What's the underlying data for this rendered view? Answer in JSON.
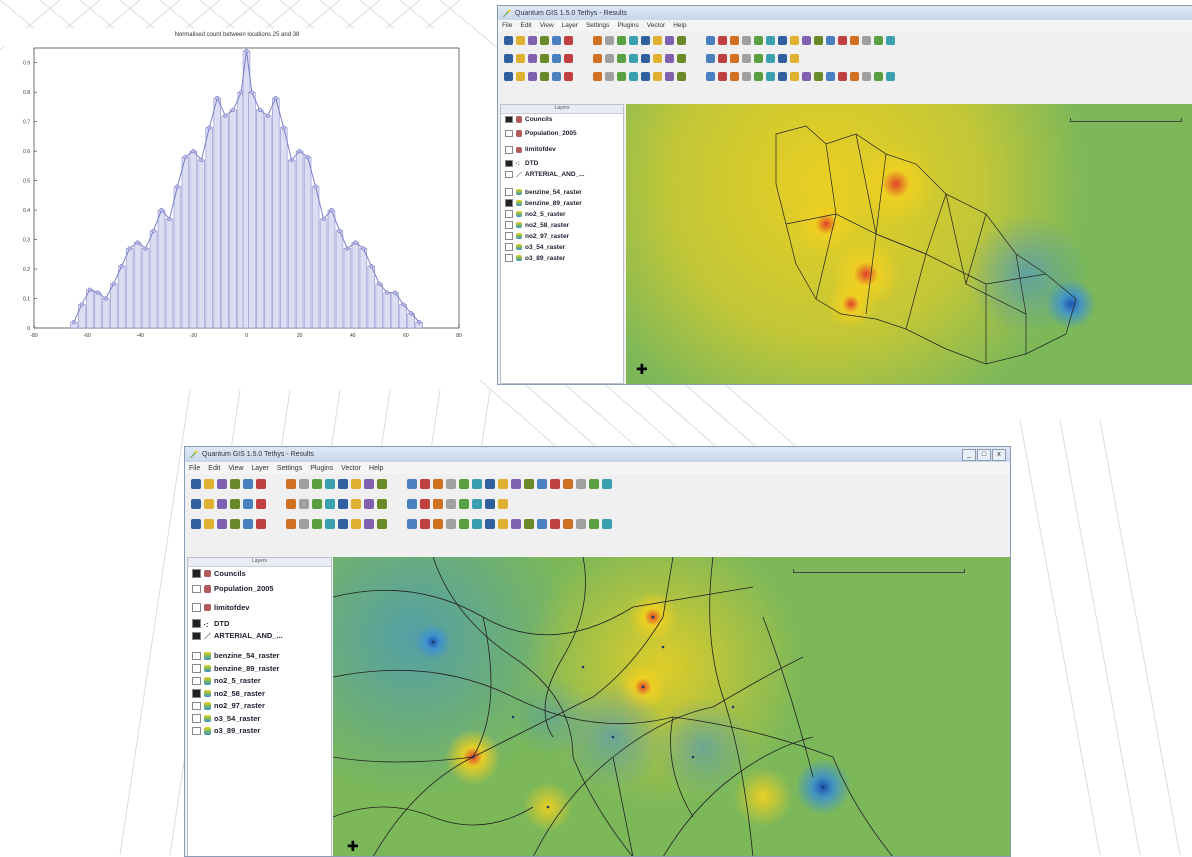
{
  "chart_data": {
    "type": "bar",
    "title": "Normalised count between locations 25 and 38",
    "xticks": [
      "-80",
      "-60",
      "-40",
      "-20",
      "0",
      "20",
      "40",
      "60",
      "80"
    ],
    "yticks": [
      "0",
      "0.1",
      "0.2",
      "0.3",
      "0.4",
      "0.5",
      "0.6",
      "0.7",
      "0.8",
      "0.9"
    ],
    "xlim": [
      -80,
      80
    ],
    "ylim": [
      0,
      0.95
    ],
    "x": [
      -65,
      -62,
      -59,
      -56,
      -53,
      -50,
      -47,
      -44,
      -41,
      -38,
      -35,
      -32,
      -29,
      -26,
      -23,
      -20,
      -17,
      -14,
      -11,
      -8,
      -5,
      -2,
      0,
      2,
      5,
      8,
      11,
      14,
      17,
      20,
      23,
      26,
      29,
      32,
      35,
      38,
      41,
      44,
      47,
      50,
      53,
      56,
      59,
      62,
      65
    ],
    "values": [
      0.02,
      0.08,
      0.13,
      0.12,
      0.1,
      0.15,
      0.21,
      0.27,
      0.29,
      0.27,
      0.33,
      0.4,
      0.37,
      0.48,
      0.58,
      0.6,
      0.57,
      0.68,
      0.78,
      0.72,
      0.74,
      0.8,
      0.94,
      0.8,
      0.74,
      0.72,
      0.78,
      0.68,
      0.57,
      0.6,
      0.58,
      0.48,
      0.37,
      0.4,
      0.33,
      0.27,
      0.29,
      0.27,
      0.21,
      0.15,
      0.12,
      0.12,
      0.08,
      0.05,
      0.02
    ],
    "color": "#7b7fc8"
  },
  "window_top": {
    "title": "Quantum GIS 1.5.0 Tethys - Results",
    "menu": [
      "File",
      "Edit",
      "View",
      "Layer",
      "Settings",
      "Plugins",
      "Vector",
      "Help"
    ],
    "layers_panel_title": "Layers",
    "layers": [
      {
        "name": "Councils",
        "checked": true,
        "symbol": "#b05a5a"
      },
      {
        "name": "Population_2005",
        "checked": false,
        "symbol": "#b05a5a"
      },
      {
        "name": "limitofdev",
        "checked": false,
        "symbol": "#b05a5a"
      },
      {
        "name": "DTD",
        "checked": true,
        "symbol": "point-layer-icon"
      },
      {
        "name": "ARTERIAL_AND_...",
        "checked": false,
        "symbol": "line-layer-icon"
      },
      {
        "name": "benzine_54_raster",
        "checked": false,
        "symbol": "raster"
      },
      {
        "name": "benzine_89_raster",
        "checked": true,
        "symbol": "raster"
      },
      {
        "name": "no2_5_raster",
        "checked": false,
        "symbol": "raster"
      },
      {
        "name": "no2_58_raster",
        "checked": false,
        "symbol": "raster"
      },
      {
        "name": "no2_97_raster",
        "checked": false,
        "symbol": "raster"
      },
      {
        "name": "o3_54_raster",
        "checked": false,
        "symbol": "raster"
      },
      {
        "name": "o3_89_raster",
        "checked": false,
        "symbol": "raster"
      }
    ]
  },
  "window_bottom": {
    "title": "Quantum GIS 1.5.0 Tethys - Results",
    "window_buttons": [
      "_",
      "□",
      "x"
    ],
    "menu": [
      "File",
      "Edit",
      "View",
      "Layer",
      "Settings",
      "Plugins",
      "Vector",
      "Help"
    ],
    "layers_panel_title": "Layers",
    "layers": [
      {
        "name": "Councils",
        "checked": true,
        "symbol": "#b05a5a"
      },
      {
        "name": "Population_2005",
        "checked": false,
        "symbol": "#b05a5a"
      },
      {
        "name": "limitofdev",
        "checked": false,
        "symbol": "#b05a5a"
      },
      {
        "name": "DTD",
        "checked": true,
        "symbol": "point-layer-icon"
      },
      {
        "name": "ARTERIAL_AND_...",
        "checked": true,
        "symbol": "line-layer-icon"
      },
      {
        "name": "benzine_54_raster",
        "checked": false,
        "symbol": "raster"
      },
      {
        "name": "benzine_89_raster",
        "checked": false,
        "symbol": "raster"
      },
      {
        "name": "no2_5_raster",
        "checked": false,
        "symbol": "raster"
      },
      {
        "name": "no2_58_raster",
        "checked": true,
        "symbol": "raster"
      },
      {
        "name": "no2_97_raster",
        "checked": false,
        "symbol": "raster"
      },
      {
        "name": "o3_54_raster",
        "checked": false,
        "symbol": "raster"
      },
      {
        "name": "o3_89_raster",
        "checked": false,
        "symbol": "raster"
      }
    ]
  },
  "colors": {
    "map_base": "#7cb85a",
    "hot": "#e0402a",
    "warm": "#f0d020",
    "cool": "#3a8fd8"
  },
  "icons": [
    "north-arrow-icon",
    "qgis-app-icon",
    "pan-icon",
    "zoom-in-icon",
    "zoom-out-icon",
    "identify-icon",
    "save-icon",
    "open-icon"
  ]
}
